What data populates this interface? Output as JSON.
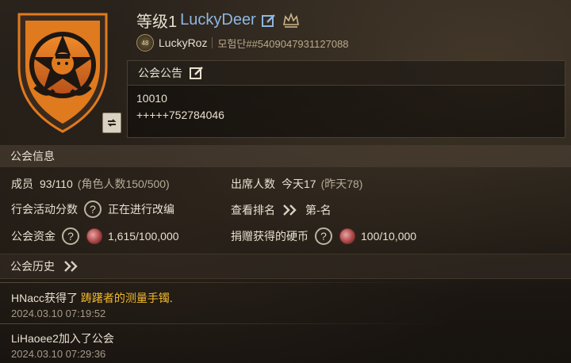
{
  "header": {
    "guild_level": "等级1",
    "guild_name": "LuckyDeer",
    "owner_name": "LuckyRoz",
    "owner_id": "모험단##5409047931127088",
    "owner_badge_text": "48"
  },
  "notice": {
    "title": "公会公告",
    "line1": "10010",
    "line2": "+++++752784046"
  },
  "info": {
    "title": "公会信息",
    "members_label": "成员",
    "members_value": "93/110",
    "members_extra": "(角色人数150/500)",
    "attendance_label": "出席人数",
    "attendance_today": "今天17",
    "attendance_yesterday": "(昨天78)",
    "activity_label": "行会活动分数",
    "activity_value": "正在进行改编",
    "ranking_label": "查看排名",
    "ranking_value": "第-名",
    "funds_label": "公会资金",
    "funds_value": "1,615/100,000",
    "donation_label": "捐赠获得的硬币",
    "donation_value": "100/10,000"
  },
  "history": {
    "title": "公会历史",
    "items": [
      {
        "prefix": "HNacc获得了 ",
        "item": "踌躇者的测量手镯",
        "suffix": ".",
        "time": "2024.03.10 07:19:52"
      },
      {
        "prefix": "LiHaoee2加入了公会",
        "item": "",
        "suffix": "",
        "time": "2024.03.10 07:29:36"
      }
    ]
  },
  "colors": {
    "guild_name": "#8fb6e0",
    "item_highlight": "#f0b92c",
    "emblem_orange": "#e07a1e"
  },
  "icons": [
    "edit-icon",
    "crown-icon",
    "help-icon",
    "coin-icon",
    "chevron-double-right-icon",
    "emblem-swap-icon"
  ]
}
